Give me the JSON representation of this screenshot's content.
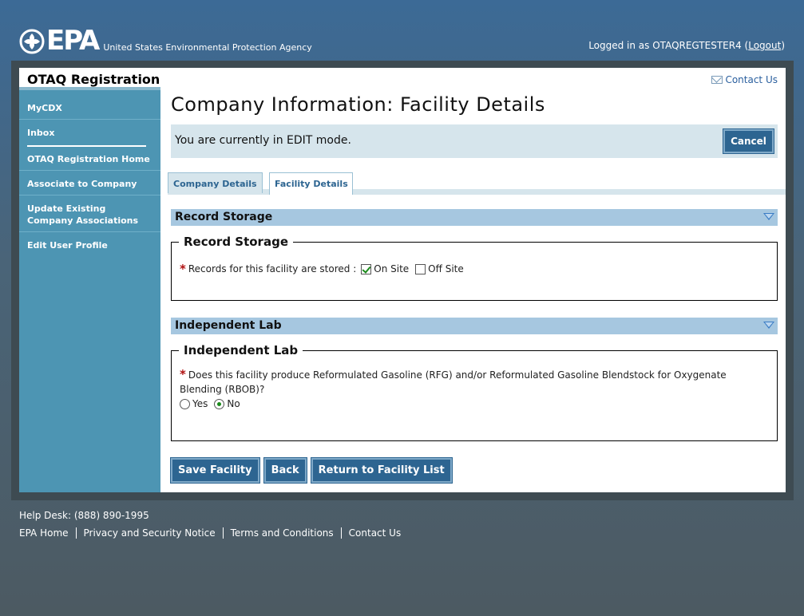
{
  "header": {
    "logo_text": "EPA",
    "agency_name": "United States Environmental Protection Agency",
    "login_prefix": "Logged in as OTAQREGTESTER4 (",
    "logout_label": "Logout",
    "login_suffix": ")"
  },
  "sidebar": {
    "title": "OTAQ Registration",
    "items": [
      {
        "label": "MyCDX"
      },
      {
        "label": "Inbox"
      },
      {
        "label": "OTAQ Registration Home"
      },
      {
        "label": "Associate to Company"
      },
      {
        "label": "Update Existing Company Associations"
      },
      {
        "label": "Edit User Profile"
      }
    ]
  },
  "main": {
    "contact_us": "Contact Us",
    "page_title": "Company Information: Facility Details",
    "edit_mode_text": "You are currently in EDIT mode.",
    "cancel_label": "Cancel",
    "tabs": [
      {
        "label": "Company Details",
        "active": false
      },
      {
        "label": "Facility Details",
        "active": true
      }
    ],
    "record_storage": {
      "section_title": "Record Storage",
      "legend": "Record Storage",
      "question": "Records for this facility are stored :",
      "on_site_label": "On Site",
      "on_site_checked": true,
      "off_site_label": "Off Site",
      "off_site_checked": false
    },
    "independent_lab": {
      "section_title": "Independent Lab",
      "legend": "Independent Lab",
      "question_line1": "Does this facility produce Reformulated Gasoline (RFG) and/or Reformulated Gasoline Blendstock for Oxygenate",
      "question_line2": "Blending (RBOB)?",
      "yes_label": "Yes",
      "no_label": "No",
      "selected": "No"
    },
    "buttons": {
      "save": "Save Facility",
      "back": "Back",
      "return": "Return to Facility List"
    }
  },
  "footer": {
    "help_desk": "Help Desk: (888) 890-1995",
    "links": [
      "EPA Home",
      "Privacy and Security Notice",
      "Terms and Conditions",
      "Contact Us"
    ]
  },
  "colors": {
    "button_blue": "#2d6591",
    "sidebar_blue": "#4d95b3",
    "section_bar": "#a6c7e0"
  }
}
